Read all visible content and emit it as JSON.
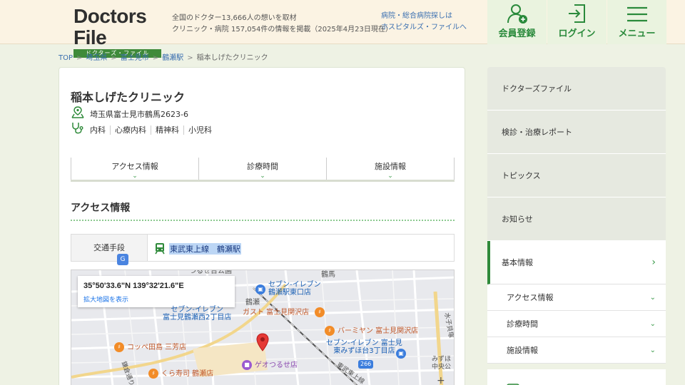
{
  "header": {
    "logo_title": "Doctors File",
    "logo_sub": "ドクターズ・ファイル",
    "tagline_line1": "全国のドクター13,666人の想いを取材",
    "tagline_line2": "クリニック・病院 157,054件の情報を掲載（2025年4月23日現在）",
    "hosp_line1": "病院・総合病院探しは",
    "hosp_line2": "ホスピタルズ・ファイルへ",
    "register_label": "会員登録",
    "login_label": "ログイン",
    "menu_label": "メニュー"
  },
  "breadcrumb": {
    "items": [
      "TOP",
      "埼玉県",
      "富士見市",
      "鶴瀬駅"
    ],
    "current": "稲本しげたクリニック"
  },
  "clinic": {
    "name": "稲本しげたクリニック",
    "address": "埼玉県富士見市鶴馬2623-6",
    "departments": [
      "内科",
      "心療内科",
      "精神科",
      "小児科"
    ]
  },
  "tabs": [
    {
      "label": "アクセス情報"
    },
    {
      "label": "診療時間"
    },
    {
      "label": "施設情報"
    }
  ],
  "access": {
    "section_title": "アクセス情報",
    "transport_label": "交通手段",
    "transport_value": "東武東上線　鶴瀬駅"
  },
  "map": {
    "coords": "35°50'33.6\"N 139°32'21.6\"E",
    "enlarge": "拡大地図を表示",
    "labels": {
      "tsurusedaiichi": "つるせ台公園",
      "tsuruma": "鶴馬",
      "seven_east": "セブン-イレブン\n鶴瀬駅東口店",
      "tsuruse_station": "鶴瀬",
      "seven_west": "セブン-イレブン\n富士見鶴瀬西2丁目店",
      "gusto": "ガスト 富士見関沢店",
      "bamiyan": "バーミヤン 富士見関沢店",
      "coppe": "コッペ田島 三芳店",
      "geo": "ゲオつるせ店",
      "seven_south": "セブン-イレブン 富士見\n東みずほ台3丁目店",
      "kura": "くら寿司 鶴瀬店",
      "tobu_line": "東武東上線",
      "kamakura": "鎌倉通り",
      "route": "266",
      "mizuho": "みずほ\n中央公",
      "mizuko": "水子貝塚"
    }
  },
  "sidebar": {
    "items": [
      {
        "label": "ドクターズファイル"
      },
      {
        "label": "検診・治療レポート"
      },
      {
        "label": "トピックス"
      },
      {
        "label": "お知らせ"
      }
    ],
    "active": {
      "label": "基本情報"
    },
    "subitems": [
      {
        "label": "アクセス情報"
      },
      {
        "label": "診療時間"
      },
      {
        "label": "施設情報"
      }
    ]
  },
  "colors": {
    "brand_green": "#2f8a3a",
    "header_bg": "#fbf3e3",
    "page_bg": "#eef2e4",
    "link_blue": "#3a6fb0"
  }
}
